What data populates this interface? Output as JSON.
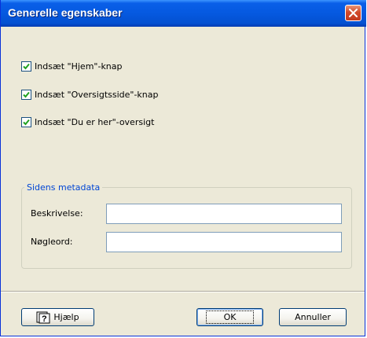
{
  "window": {
    "title": "Generelle egenskaber"
  },
  "options": [
    {
      "label": "Indsæt \"Hjem\"-knap",
      "checked": true
    },
    {
      "label": "Indsæt \"Oversigtsside\"-knap",
      "checked": true
    },
    {
      "label": "Indsæt \"Du er her\"-oversigt",
      "checked": true
    }
  ],
  "metadata": {
    "legend": "Sidens metadata",
    "description_label": "Beskrivelse:",
    "description_value": "",
    "keywords_label": "Nøgleord:",
    "keywords_value": ""
  },
  "buttons": {
    "help": "Hjælp",
    "ok": "OK",
    "cancel": "Annuller"
  },
  "colors": {
    "titlebar": "#0559e0",
    "window_bg": "#ece9d8",
    "legend_text": "#0046d5",
    "close": "#d2492a"
  }
}
